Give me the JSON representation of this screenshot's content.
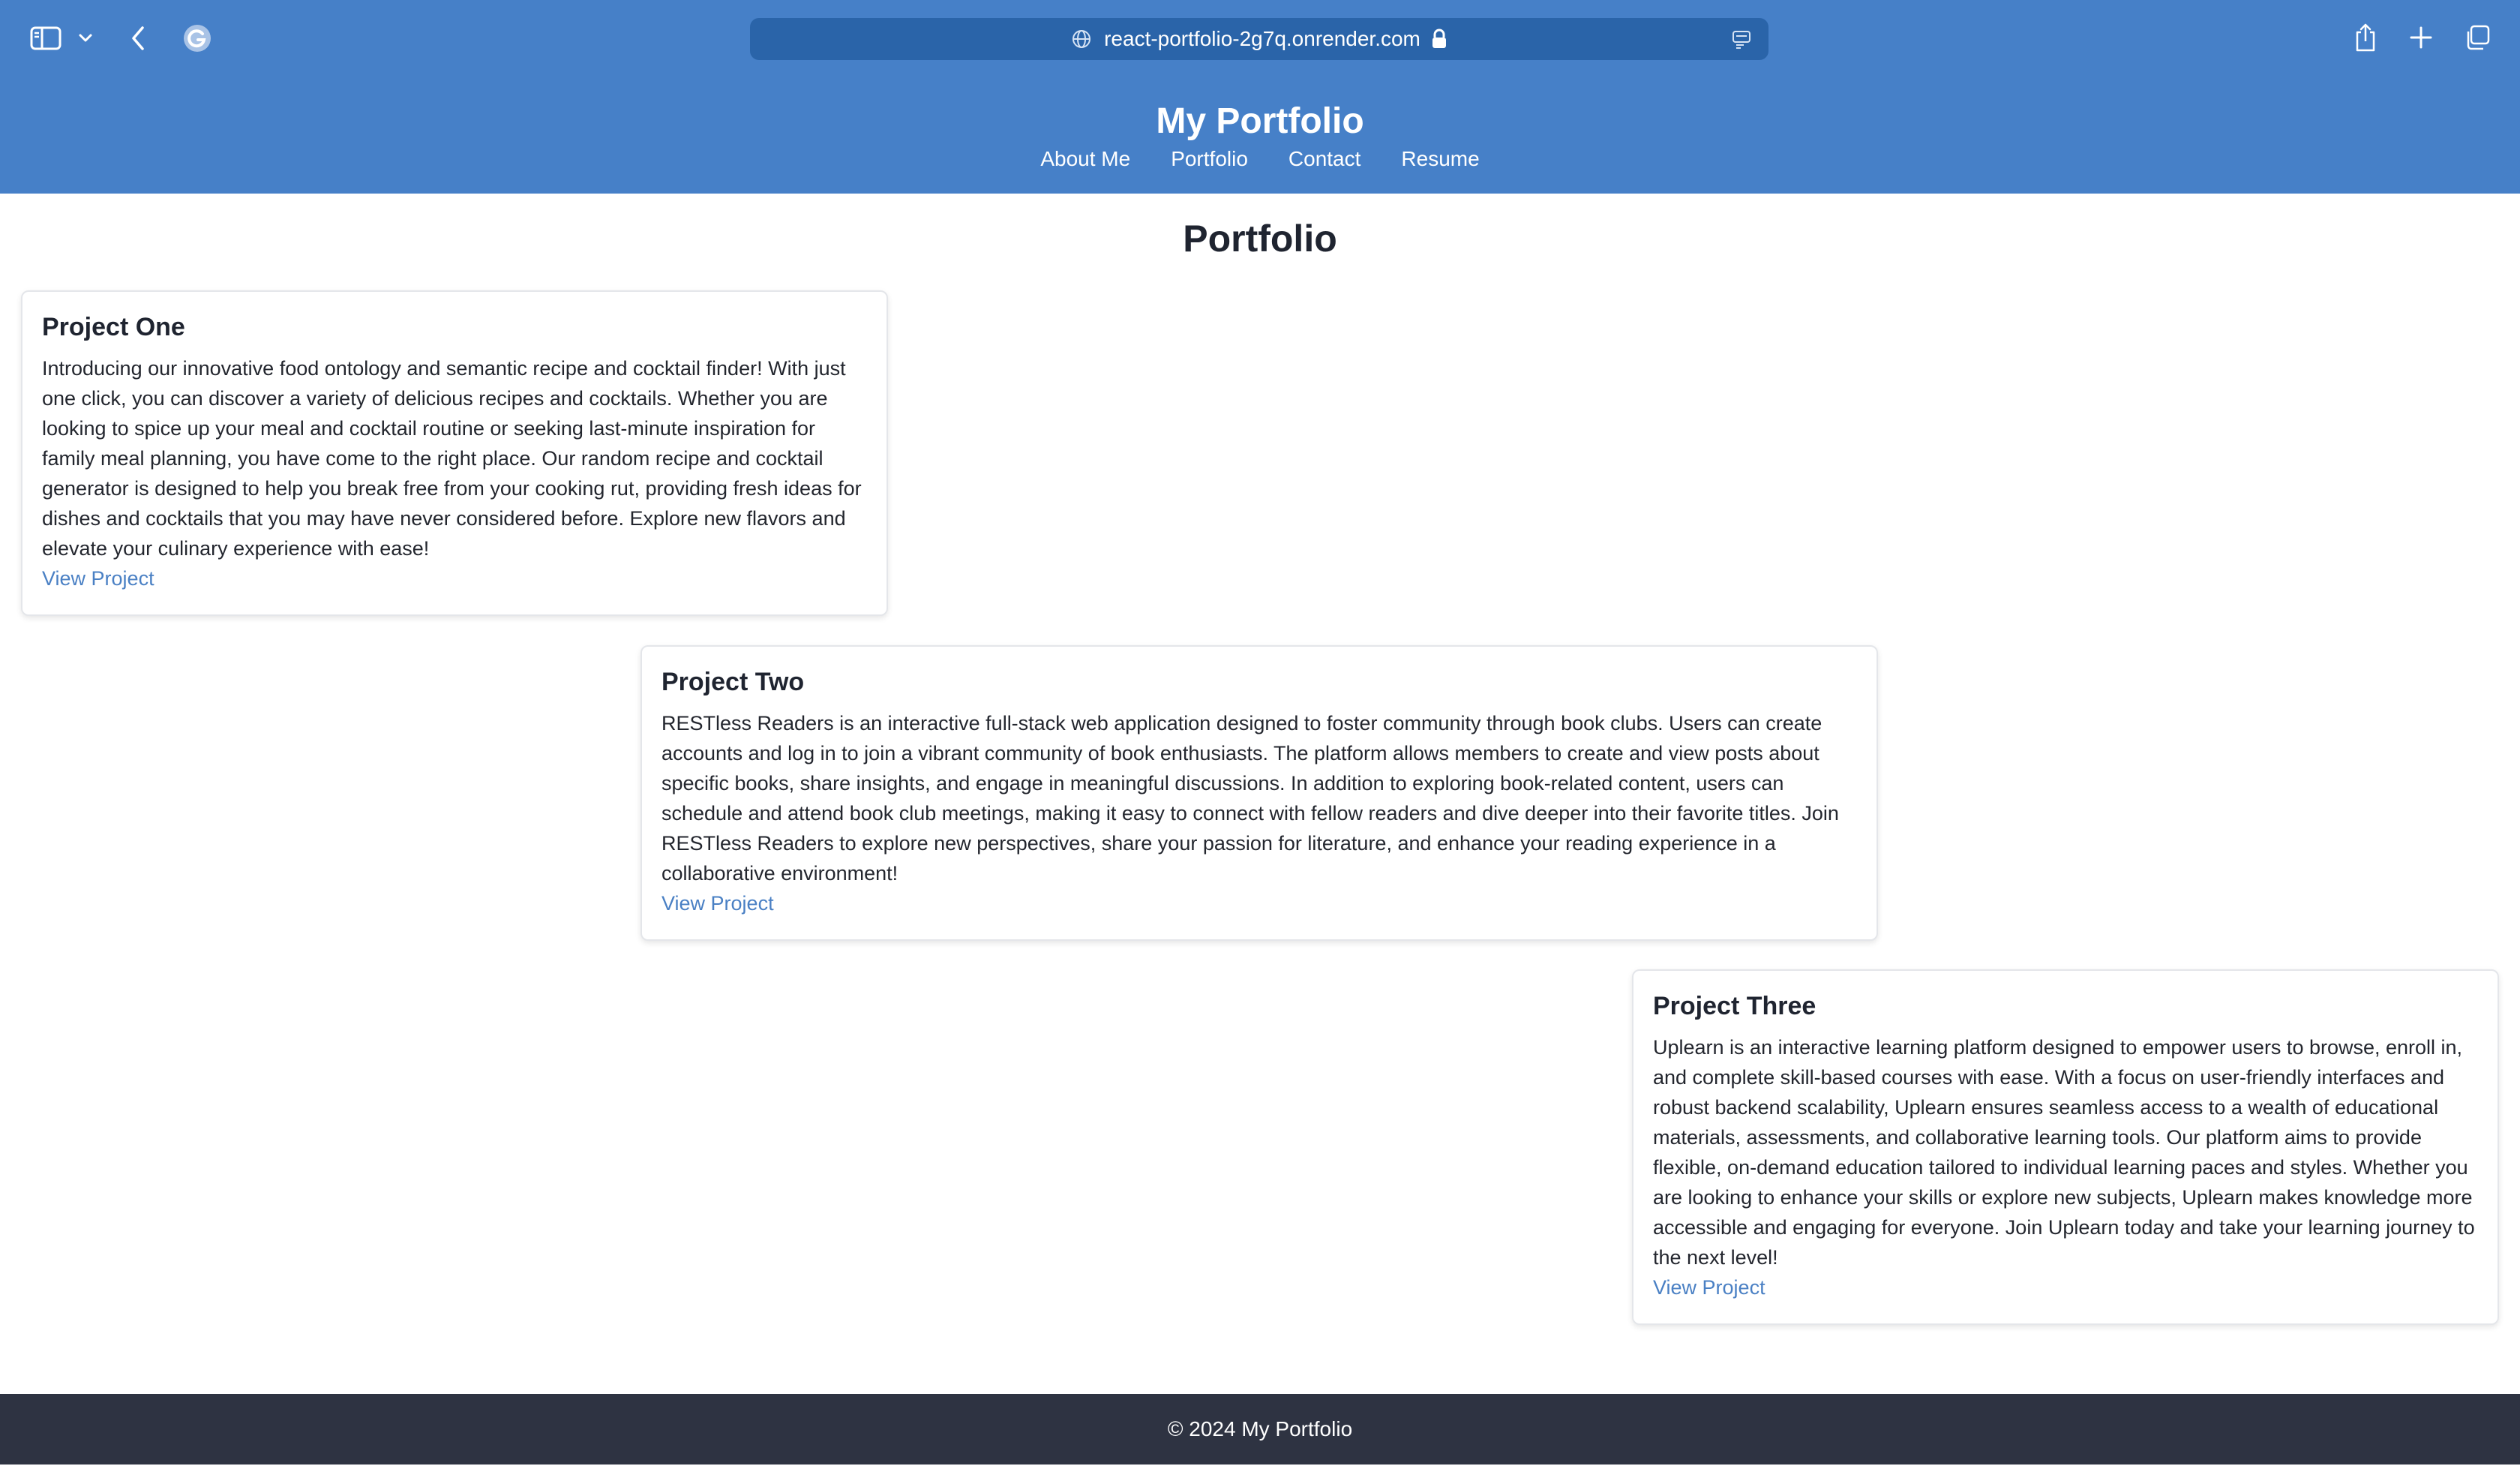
{
  "browser": {
    "url": "react-portfolio-2g7q.onrender.com",
    "icons": {
      "sidebar": "sidebar-toggle-icon",
      "sidebar_menu": "chevron-down-icon",
      "back": "chevron-left-icon",
      "extension": "grammarly-icon",
      "site": "globe-icon",
      "secure": "lock-icon",
      "reader": "reader-mode-icon",
      "share": "share-icon",
      "new_tab": "plus-icon",
      "tabs": "tab-overview-icon"
    }
  },
  "header": {
    "title": "My Portfolio",
    "nav": [
      "About Me",
      "Portfolio",
      "Contact",
      "Resume"
    ]
  },
  "main": {
    "heading": "Portfolio",
    "projects": [
      {
        "title": "Project One",
        "description": "Introducing our innovative food ontology and semantic recipe and cocktail finder! With just one click, you can discover a variety of delicious recipes and cocktails. Whether you are looking to spice up your meal and cocktail routine or seeking last-minute inspiration for family meal planning, you have come to the right place. Our random recipe and cocktail generator is designed to help you break free from your cooking rut, providing fresh ideas for dishes and cocktails that you may have never considered before. Explore new flavors and elevate your culinary experience with ease!",
        "link": "View Project"
      },
      {
        "title": "Project Two",
        "description": "RESTless Readers is an interactive full-stack web application designed to foster community through book clubs. Users can create accounts and log in to join a vibrant community of book enthusiasts. The platform allows members to create and view posts about specific books, share insights, and engage in meaningful discussions. In addition to exploring book-related content, users can schedule and attend book club meetings, making it easy to connect with fellow readers and dive deeper into their favorite titles. Join RESTless Readers to explore new perspectives, share your passion for literature, and enhance your reading experience in a collaborative environment!",
        "link": "View Project"
      },
      {
        "title": "Project Three",
        "description": "Uplearn is an interactive learning platform designed to empower users to browse, enroll in, and complete skill-based courses with ease. With a focus on user-friendly interfaces and robust backend scalability, Uplearn ensures seamless access to a wealth of educational materials, assessments, and collaborative learning tools. Our platform aims to provide flexible, on-demand education tailored to individual learning paces and styles. Whether you are looking to enhance your skills or explore new subjects, Uplearn makes knowledge more accessible and engaging for everyone. Join Uplearn today and take your learning journey to the next level!",
        "link": "View Project"
      }
    ]
  },
  "footer": {
    "text": "© 2024 My Portfolio"
  },
  "colors": {
    "header_bg": "#4680c8",
    "url_bar_bg": "#2a64a9",
    "link": "#4a80c4",
    "footer_bg": "#2e3342"
  }
}
